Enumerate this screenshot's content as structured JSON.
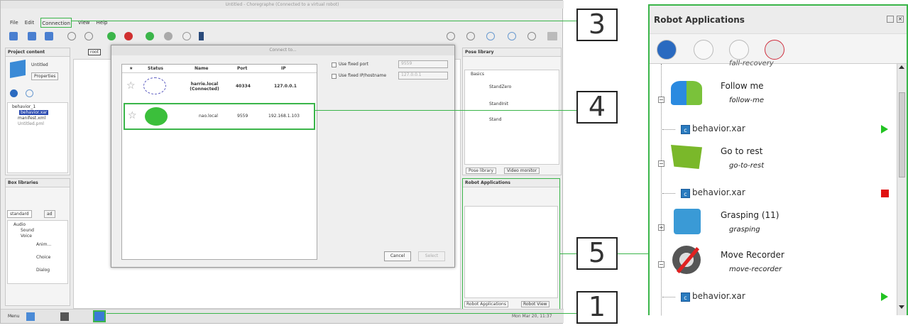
{
  "window": {
    "title": "Untitled - Choregraphe (Connected to a virtual robot)"
  },
  "menu": [
    "File",
    "Edit",
    "Connection",
    "View",
    "Help"
  ],
  "project_panel": {
    "title": "Project content",
    "project_name": "Untitled",
    "properties_label": "Properties",
    "tree": [
      "behavior_1",
      "behavior.xar",
      "manifest.xml",
      "Untitled.pml"
    ]
  },
  "root_label": "root",
  "box_libraries": {
    "title": "Box libraries",
    "tabs": [
      "standard",
      "ad"
    ],
    "tree": [
      "Audio",
      "Sound",
      "Voice",
      "Anim...",
      "Choice",
      "Dialog"
    ]
  },
  "dialog": {
    "title": "Connect to...",
    "columns": [
      "★",
      "Status",
      "Name",
      "Port",
      "IP"
    ],
    "rows": [
      {
        "name": "harrie.local (Connected)",
        "port": "40334",
        "ip": "127.0.0.1"
      },
      {
        "name": "nao.local",
        "port": "9559",
        "ip": "192.168.1.103"
      }
    ],
    "use_fixed_port": "Use fixed port",
    "port_value": "9559",
    "use_fixed_ip": "Use fixed IP/hostname",
    "ip_value": "127.0.0.1",
    "cancel": "Cancel",
    "select": "Select"
  },
  "pose_library": {
    "title": "Pose library",
    "group": "Basics",
    "poses": [
      "StandZero",
      "StandInit",
      "Stand"
    ],
    "tabs": [
      "Pose library",
      "Video monitor"
    ]
  },
  "robot_apps_small": {
    "title": "Robot Applications",
    "tabs": [
      "Robot Applications",
      "Robot View"
    ]
  },
  "taskbar": {
    "menu_label": "Menu",
    "clock": "Mon Mar 20, 11:37"
  },
  "callouts": [
    "3",
    "4",
    "5",
    "1"
  ],
  "robot_apps": {
    "title": "Robot Applications",
    "apps": [
      {
        "name": "Follow me",
        "id": "follow-me",
        "behavior": "behavior.xar",
        "state": "play"
      },
      {
        "name": "Go to rest",
        "id": "go-to-rest",
        "behavior": "behavior.xar",
        "state": "stop"
      },
      {
        "name": "Grasping (11)",
        "id": "grasping"
      },
      {
        "name": "Move Recorder",
        "id": "move-recorder",
        "behavior": "behavior.xar",
        "state": "play"
      }
    ],
    "partial_top": "fall-recovery"
  },
  "colors": {
    "callout": "#3bb54a",
    "play": "#22c322",
    "stop": "#e01010"
  }
}
